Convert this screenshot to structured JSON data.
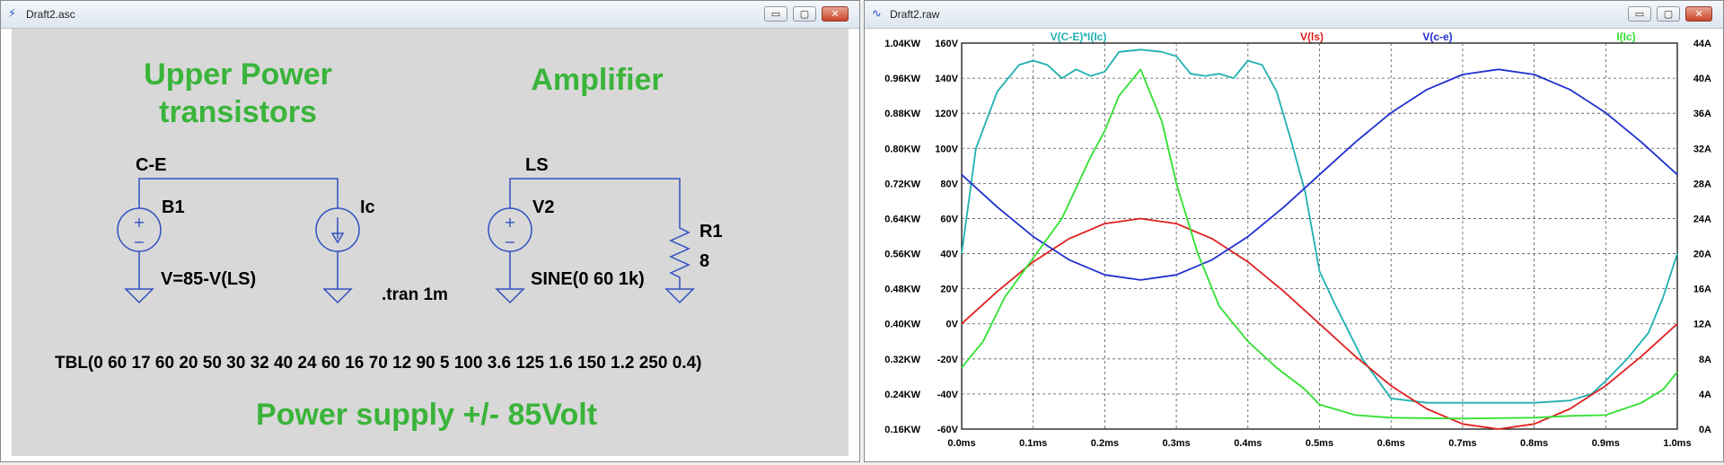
{
  "left_window": {
    "title": "Draft2.asc",
    "icon": "ltspice-icon",
    "buttons": {
      "minimize": "▭",
      "maximize": "▢",
      "close": "✕"
    }
  },
  "right_window": {
    "title": "Draft2.raw",
    "icon": "waveform-icon",
    "buttons": {
      "minimize": "▭",
      "maximize": "▢",
      "close": "✕"
    }
  },
  "schematic": {
    "heading_upper_line1": "Upper Power",
    "heading_upper_line2": "transistors",
    "heading_amplifier": "Amplifier",
    "net_ce": "C-E",
    "net_ls": "LS",
    "b1_name": "B1",
    "b1_value": "V=85-V(LS)",
    "ic_name": "Ic",
    "v2_name": "V2",
    "v2_value": "SINE(0 60 1k)",
    "r1_name": "R1",
    "r1_value": "8",
    "tran": ".tran 1m",
    "tbl": "TBL(0 60 17 60 20 50 30 32 40 24 60 16 70 12 90 5 100 3.6 125 1.6 150 1.2 250 0.4)",
    "footer": "Power supply +/- 85Volt",
    "colors": {
      "background": "#d8d8d8",
      "wire": "#3050c0",
      "text_green": "#3ab43a"
    }
  },
  "chart_data": {
    "type": "line",
    "x_ticks": [
      "0.0ms",
      "0.1ms",
      "0.2ms",
      "0.3ms",
      "0.4ms",
      "0.5ms",
      "0.6ms",
      "0.7ms",
      "0.8ms",
      "0.9ms",
      "1.0ms"
    ],
    "left_outer_ticks": [
      "1.04KW",
      "0.96KW",
      "0.88KW",
      "0.80KW",
      "0.72KW",
      "0.64KW",
      "0.56KW",
      "0.48KW",
      "0.40KW",
      "0.32KW",
      "0.24KW",
      "0.16KW"
    ],
    "left_inner_ticks": [
      "160V",
      "140V",
      "120V",
      "100V",
      "80V",
      "60V",
      "40V",
      "20V",
      "0V",
      "-20V",
      "-40V",
      "-60V"
    ],
    "right_ticks": [
      "44A",
      "40A",
      "36A",
      "32A",
      "28A",
      "24A",
      "20A",
      "16A",
      "12A",
      "8A",
      "4A",
      "0A"
    ],
    "xlim": [
      0,
      1.0
    ],
    "ylim_voltage": [
      -60,
      160
    ],
    "ylim_current": [
      0,
      44
    ],
    "ylim_power": [
      0.16,
      1.04
    ],
    "grid": true,
    "series": [
      {
        "name": "V(C-E)*I(Ic)",
        "axis": "power",
        "color": "#20b0b0",
        "x": [
          0,
          0.02,
          0.05,
          0.08,
          0.1,
          0.12,
          0.14,
          0.16,
          0.18,
          0.2,
          0.22,
          0.25,
          0.28,
          0.3,
          0.32,
          0.34,
          0.36,
          0.38,
          0.4,
          0.42,
          0.44,
          0.46,
          0.48,
          0.5,
          0.52,
          0.56,
          0.6,
          0.65,
          0.7,
          0.75,
          0.8,
          0.85,
          0.88,
          0.9,
          0.93,
          0.96,
          0.98,
          1.0
        ],
        "y": [
          0.56,
          0.8,
          0.93,
          0.99,
          1.0,
          0.99,
          0.96,
          0.98,
          0.965,
          0.975,
          1.02,
          1.025,
          1.02,
          1.01,
          0.97,
          0.965,
          0.97,
          0.96,
          1.0,
          0.99,
          0.93,
          0.82,
          0.7,
          0.52,
          0.45,
          0.32,
          0.23,
          0.22,
          0.22,
          0.22,
          0.22,
          0.225,
          0.24,
          0.27,
          0.32,
          0.38,
          0.46,
          0.56
        ]
      },
      {
        "name": "V(ls)",
        "axis": "voltage",
        "color": "#e02020",
        "x": [
          0,
          0.05,
          0.1,
          0.15,
          0.2,
          0.25,
          0.3,
          0.35,
          0.4,
          0.45,
          0.5,
          0.55,
          0.6,
          0.65,
          0.7,
          0.75,
          0.8,
          0.85,
          0.9,
          0.95,
          1.0
        ],
        "y": [
          0,
          18.5,
          35.3,
          48.5,
          57.1,
          60,
          57.1,
          48.5,
          35.3,
          18.5,
          0,
          -18.5,
          -35.3,
          -48.5,
          -57.1,
          -60,
          -57.1,
          -48.5,
          -35.3,
          -18.5,
          0
        ]
      },
      {
        "name": "V(c-e)",
        "axis": "voltage",
        "color": "#2030d0",
        "x": [
          0,
          0.05,
          0.1,
          0.15,
          0.2,
          0.25,
          0.3,
          0.35,
          0.4,
          0.45,
          0.5,
          0.55,
          0.6,
          0.65,
          0.7,
          0.75,
          0.8,
          0.85,
          0.9,
          0.95,
          1.0
        ],
        "y": [
          85,
          66.5,
          49.7,
          36.5,
          27.9,
          25,
          27.9,
          36.5,
          49.7,
          66.5,
          85,
          103.5,
          120.3,
          133.5,
          142.1,
          145,
          142.1,
          133.5,
          120.3,
          103.5,
          85
        ]
      },
      {
        "name": "I(Ic)",
        "axis": "current",
        "color": "#30e030",
        "x": [
          0,
          0.03,
          0.06,
          0.1,
          0.14,
          0.18,
          0.2,
          0.22,
          0.25,
          0.28,
          0.3,
          0.33,
          0.36,
          0.4,
          0.44,
          0.48,
          0.5,
          0.55,
          0.6,
          0.7,
          0.8,
          0.85,
          0.9,
          0.95,
          0.98,
          1.0
        ],
        "y": [
          7,
          10,
          15,
          19.5,
          24,
          31,
          34,
          38,
          41,
          35,
          28,
          20,
          14,
          10,
          7,
          4.5,
          2.8,
          1.6,
          1.3,
          1.2,
          1.3,
          1.5,
          1.6,
          3,
          4.5,
          6.5
        ]
      }
    ]
  }
}
